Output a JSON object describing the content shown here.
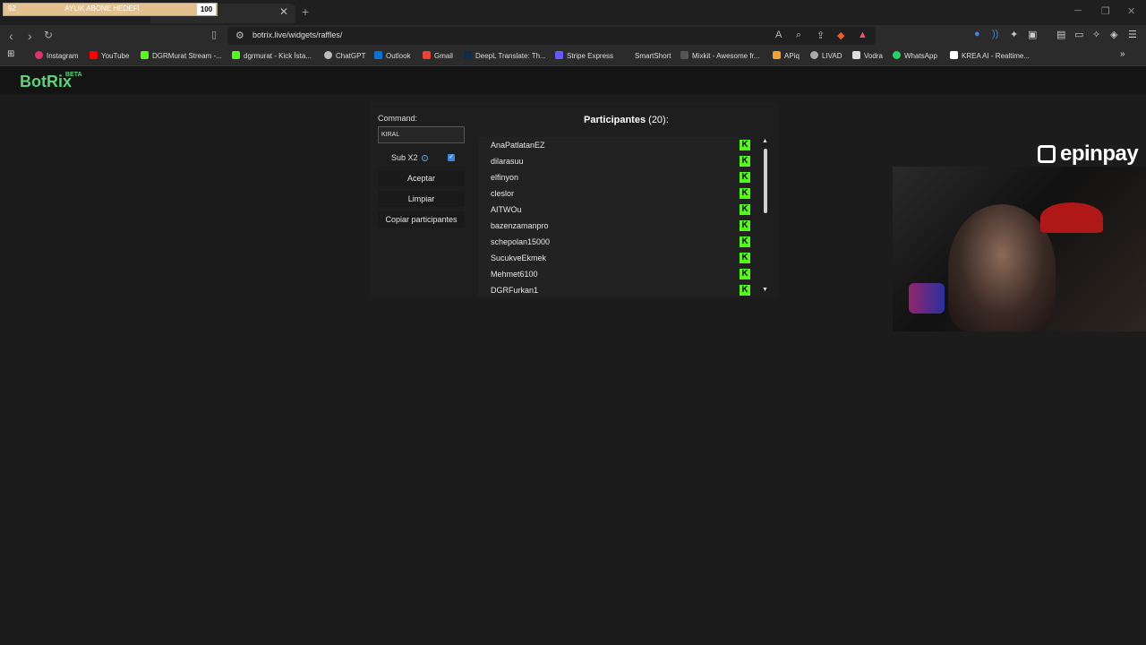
{
  "goal": {
    "start": "92",
    "title": "AYLIK ABONE HEDEFİ",
    "end": "100",
    "progress": 0.92
  },
  "browser": {
    "url": "botrix.live/widgets/raffles/"
  },
  "bookmarks": [
    "Instagram",
    "YouTube",
    "DGRMurat Stream -...",
    "dgrmurat - Kick İsta...",
    "ChatGPT",
    "Outlook",
    "Gmail",
    "DeepL Translate: Th...",
    "Stripe Express",
    "SmartShort",
    "Mixkit - Awesome fr...",
    "APiq",
    "LIVAD",
    "Vodra",
    "WhatsApp",
    "KREA AI - Realtime..."
  ],
  "site": {
    "logo": "BotRix",
    "beta": "BETA"
  },
  "raffle": {
    "command_label": "Command:",
    "command_value": "KIRAL",
    "sub_label": "Sub X2",
    "sub_checked": true,
    "accept_label": "Aceptar",
    "clear_label": "Limpiar",
    "copy_label": "Copiar participantes",
    "participants_label": "Participantes",
    "participants_count": "(20):",
    "participants": [
      "AnaPatlatanEZ",
      "dilarasuu",
      "elfinyon",
      "cleslor",
      "AITWOu",
      "bazenzamanpro",
      "schepolan15000",
      "SucukveEkmek",
      "Mehmet6100",
      "DGRFurkan1"
    ],
    "platform_badge": "K"
  },
  "overlay": {
    "sponsor": "epinpay"
  }
}
